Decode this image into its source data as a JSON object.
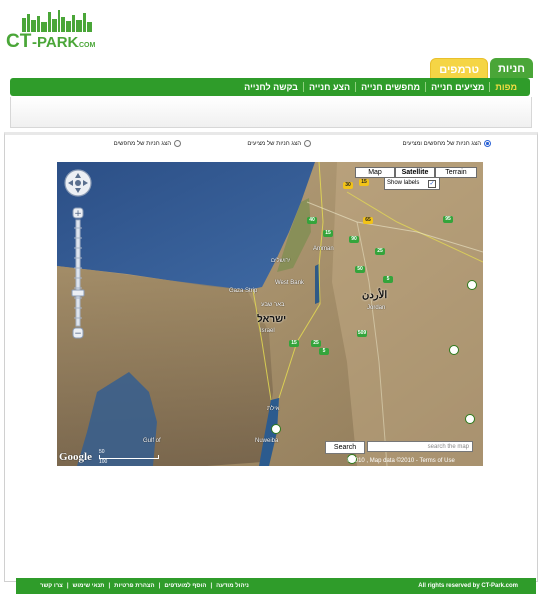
{
  "logo": {
    "text_ct": "CT",
    "text_rest": "-PARK",
    "text_com": ".COM"
  },
  "tabs": [
    {
      "label": "חניות",
      "active": true
    },
    {
      "label": "טרמפים",
      "active": false
    }
  ],
  "nav": [
    {
      "label": "מפות",
      "active": true
    },
    {
      "label": "מציעים חנייה",
      "active": false
    },
    {
      "label": "מחפשים חנייה",
      "active": false
    },
    {
      "label": "הצע חנייה",
      "active": false
    },
    {
      "label": "בקשה לחנייה",
      "active": false
    }
  ],
  "radios": [
    {
      "label": "הצג חניות של מחפשים ומציעים",
      "checked": true
    },
    {
      "label": "הצג חניות של מציעים",
      "checked": false
    },
    {
      "label": "הצג חניות של מחפשים",
      "checked": false
    }
  ],
  "map": {
    "type_buttons": [
      "Map",
      "Satellite",
      "Terrain"
    ],
    "selected_type": "Satellite",
    "show_labels": "Show labels",
    "search_button": "Search",
    "search_placeholder": "search the map",
    "attribution": "©2010 , Map data ©2010 - Terms of Use",
    "scale_top": "50",
    "scale_bottom": "100",
    "google": "Google",
    "labels": {
      "westbank": "West Bank",
      "gaza": "Gaza Strip",
      "jordan_he": "الأردن",
      "jordan_en": "Jordan",
      "israel_he": "ישראל",
      "israel_en": "Israel",
      "nuweiba": "Nuweiba",
      "gulf": "Gulf of",
      "amman": "Amman",
      "jerusalem": "ירושלים",
      "beer": "באר שבע",
      "eilat": "אילת"
    },
    "shields": [
      "15",
      "30",
      "40",
      "15",
      "65",
      "90",
      "25",
      "50",
      "5",
      "95",
      "509",
      "5",
      "25",
      "15",
      "65",
      "15",
      "45",
      "35"
    ]
  },
  "footer": {
    "copyright": "All rights reserved by CT-Park.com",
    "links": [
      "ניהול מודעה",
      "הוסף למועדפים",
      "הצהרת פרטיות",
      "תנאי שימוש",
      "צרו קשר"
    ]
  }
}
